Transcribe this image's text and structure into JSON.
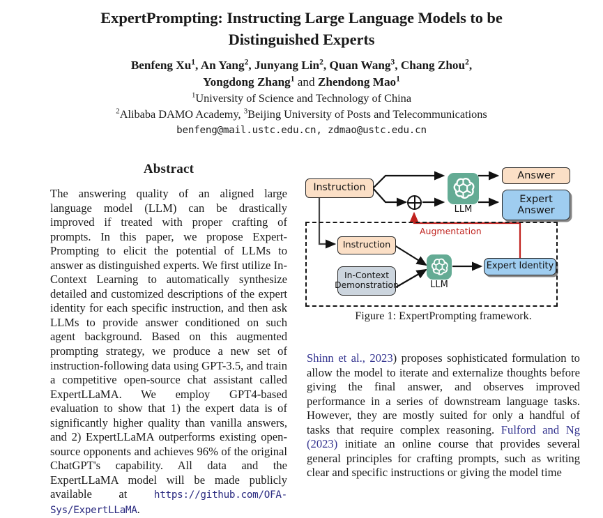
{
  "paper": {
    "title": "ExpertPrompting: Instructing Large Language Models to be Distinguished Experts",
    "authors": {
      "line1_part1": "Benfeng Xu",
      "line1_sup1": "1",
      "line1_part2": ", An Yang",
      "line1_sup2": "2",
      "line1_part3": ", Junyang Lin",
      "line1_sup3": "2",
      "line1_part4": ", Quan Wang",
      "line1_sup4": "3",
      "line1_part5": ", Chang Zhou",
      "line1_sup5": "2",
      "line1_part6": ",",
      "line2_part1": "Yongdong Zhang",
      "line2_sup1": "1",
      "line2_conj": " and ",
      "line2_part2": "Zhendong Mao",
      "line2_sup2": "1",
      "affil1_sup": "1",
      "affil1": "University of Science and Technology of China",
      "affil2_sup": "2",
      "affil2_a": "Alibaba DAMO Academy, ",
      "affil2_sup2": "3",
      "affil2_b": "Beijing University of Posts and Telecommunications",
      "emails": "benfeng@mail.ustc.edu.cn, zdmao@ustc.edu.cn"
    }
  },
  "abstract": {
    "heading": "Abstract",
    "text_before_url": "The answering quality of an aligned large language model (LLM) can be drastically improved if treated with proper crafting of prompts. In this paper, we propose Expert-Prompting to elicit the potential of LLMs to answer as distinguished experts. We first utilize In-Context Learning to automatically synthesize detailed and customized descriptions of the expert identity for each specific instruction, and then ask LLMs to provide answer conditioned on such agent background. Based on this augmented prompting strategy, we produce a new set of instruction-following data using GPT-3.5, and train a competitive open-source chat assistant called ExpertLLaMA. We employ GPT4-based evaluation to show that 1) the expert data is of significantly higher quality than vanilla answers, and 2) ExpertLLaMA outperforms existing open-source opponents and achieves 96% of the original ChatGPT's capability. All data and the ExpertLLaMA model will be made publicly available at ",
    "url": "https://github.com/OFA-Sys/ExpertLLaMA",
    "text_after_url": "."
  },
  "figure": {
    "caption": "Figure 1: ExpertPrompting framework.",
    "nodes": {
      "instruction_top": "Instruction",
      "instruction_bottom": "Instruction",
      "in_context_demo": "In-Context\nDemonstration",
      "llm_top": "LLM",
      "llm_bottom": "LLM",
      "answer": "Answer",
      "expert_answer": "Expert\nAnswer",
      "expert_identity": "Expert Identity",
      "augmentation": "Augmentation",
      "plus_operator": "plus-circle"
    },
    "colors": {
      "peach": "#fbdfc6",
      "blue": "#9fcdf0",
      "gray_blue": "#ccd5de",
      "llm_green": "#64ab94",
      "augmentation_red": "#c0221e",
      "outline": "#262626"
    }
  },
  "right_column": {
    "paragraph_part1": "Shinn et al., 2023",
    "paragraph_part2": ") proposes sophisticated formulation to allow the model to iterate and externalize thoughts before giving the final answer, and observes improved performance in a series of downstream language tasks. However, they are mostly suited for only a handful of tasks that require complex reasoning.  ",
    "paragraph_part3": "Fulford and Ng (2023)",
    "paragraph_part4": " initiate an online course that provides several general principles for crafting prompts, such as writing clear and specific instructions or giving the model time"
  }
}
